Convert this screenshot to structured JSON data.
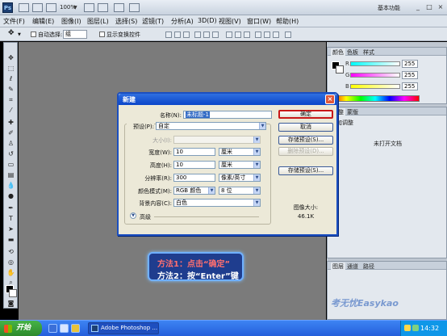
{
  "app": {
    "logo": "Ps",
    "zoom": "100%",
    "workspace": "基本功能"
  },
  "menu": [
    "文件(F)",
    "编辑(E)",
    "图像(I)",
    "图层(L)",
    "选择(S)",
    "滤镜(T)",
    "分析(A)",
    "3D(D)",
    "视图(V)",
    "窗口(W)",
    "帮助(H)"
  ],
  "options": {
    "auto_select": "自动选择:",
    "auto_select_value": "组",
    "show_transform": "显示变换控件"
  },
  "panels": {
    "color_tabs": [
      "颜色",
      "色板",
      "样式"
    ],
    "r": "R",
    "g": "G",
    "b": "B",
    "r_val": "255",
    "g_val": "255",
    "b_val": "255",
    "adjust_tabs": [
      "调整",
      "蒙版"
    ],
    "adjust_title": "添加调整",
    "adjust_msg": "未打开文档",
    "layers_tabs": [
      "图层",
      "通道",
      "路径"
    ]
  },
  "dialog": {
    "title": "新建",
    "name_label": "名称(N):",
    "name_value": "未标题-1",
    "preset_label": "预设(P):",
    "preset_value": "自定",
    "size_label": "大小(I):",
    "width_label": "宽度(W):",
    "width_value": "10",
    "width_unit": "厘米",
    "height_label": "高度(H):",
    "height_value": "10",
    "height_unit": "厘米",
    "resolution_label": "分辨率(R):",
    "resolution_value": "300",
    "resolution_unit": "像素/英寸",
    "mode_label": "颜色模式(M):",
    "mode_value": "RGB 颜色",
    "bits_value": "8 位",
    "bg_label": "背景内容(C):",
    "bg_value": "白色",
    "advanced": "高级",
    "ok": "确定",
    "cancel": "取消",
    "save_preset": "存储预设(S)...",
    "delete_preset": "删除预设(D)...",
    "device_central": "存储预设(S)...",
    "image_size_label": "图像大小:",
    "image_size_value": "46.1K"
  },
  "callout": {
    "line1": "方法1：点击“确定”",
    "line2": "方法2：按“Enter”键"
  },
  "watermark": "考无忧Easykao",
  "taskbar": {
    "start": "开始",
    "task": "Adobe Photoshop ...",
    "clock": "14:32"
  },
  "colors": {
    "canvas": "#7b7b7b",
    "dialog_title": "#0b46c9",
    "callout_bg": "#1f3d8e",
    "callout_red": "#ff6f6f",
    "taskbar": "#245edb"
  }
}
